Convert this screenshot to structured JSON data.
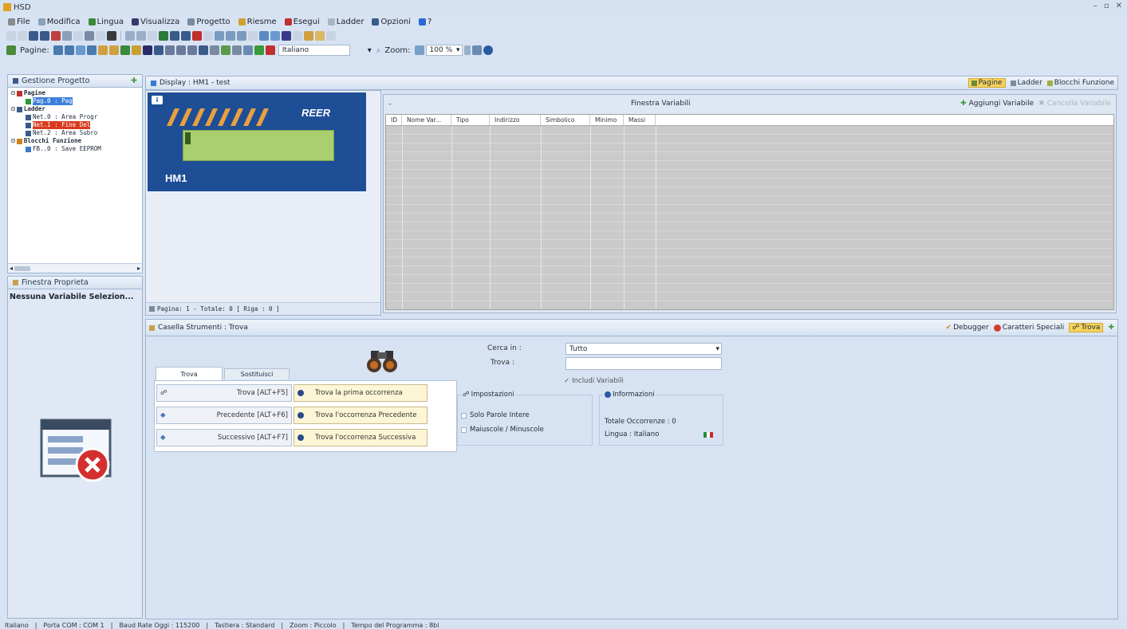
{
  "window": {
    "title": "HSD"
  },
  "menu": [
    {
      "label": "File",
      "icon": "file-icon",
      "color": "#8a8a8a"
    },
    {
      "label": "Modifica",
      "icon": "edit-icon",
      "color": "#8aa0b8"
    },
    {
      "label": "Lingua",
      "icon": "globe-icon",
      "color": "#3a8a3a"
    },
    {
      "label": "Visualizza",
      "icon": "eye-icon",
      "color": "#3a3a6a"
    },
    {
      "label": "Progetto",
      "icon": "project-icon",
      "color": "#7a8aa0"
    },
    {
      "label": "Riesme",
      "icon": "folder-icon",
      "color": "#d0a030"
    },
    {
      "label": "Esegui",
      "icon": "run-icon",
      "color": "#c03030"
    },
    {
      "label": "Ladder",
      "icon": "ladder-icon",
      "color": "#aab4c4"
    },
    {
      "label": "Opzioni",
      "icon": "options-icon",
      "color": "#3a5a8a"
    },
    {
      "label": "?",
      "icon": "help-icon",
      "color": "#2a6ad0"
    }
  ],
  "toolbar3": {
    "pagine_label": "Pagine:",
    "language_value": "Italiano",
    "zoom_label": "Zoom:",
    "zoom_value": "100 %"
  },
  "project": {
    "title": "Gestione Progetto",
    "tree": [
      {
        "text": "Pagine",
        "indent": 0,
        "icon": "pages-folder-icon",
        "style": ""
      },
      {
        "text": "Pag.0 : Pag",
        "indent": 2,
        "icon": "page-arrow-icon",
        "style": "blue"
      },
      {
        "text": "Ladder",
        "indent": 0,
        "icon": "ladder-folder-icon",
        "style": ""
      },
      {
        "text": "Net.0 : Area Progr",
        "indent": 2,
        "icon": "network-icon",
        "style": ""
      },
      {
        "text": "Net.1 : Fine Del",
        "indent": 2,
        "icon": "network-icon",
        "style": "red"
      },
      {
        "text": "Net.2 : Area Subro",
        "indent": 2,
        "icon": "network-icon",
        "style": ""
      },
      {
        "text": "Blocchi Funzione",
        "indent": 0,
        "icon": "function-block-folder-icon",
        "style": ""
      },
      {
        "text": "FB..0 : Save EEPROM",
        "indent": 2,
        "icon": "function-block-icon",
        "style": ""
      }
    ]
  },
  "properties": {
    "title": "Finestra Proprieta",
    "empty_message": "Nessuna Variabile Selezion..."
  },
  "display": {
    "title": "Display : HM1 - test",
    "brand": "REER",
    "screen_name": "HM1",
    "status": "Pagina: 1 - Totale: 0 [ Riga : 0 ]"
  },
  "view_switch": {
    "pagine": "Pagine",
    "ladder": "Ladder",
    "blocchi": "Blocchi Funzione"
  },
  "variables": {
    "title": "Finestra Variabili",
    "add_label": "Aggiungi Variabile",
    "delete_label": "Cancella Variabile",
    "columns": [
      "ID",
      "Nome Var...",
      "Tipo",
      "Indirizzo",
      "Simbolico",
      "Minimo",
      "Massi"
    ]
  },
  "tools": {
    "title": "Casella Strumenti : Trova",
    "tabs": {
      "debugger": "Debugger",
      "caratteri": "Caratteri Speciali",
      "trova": "Trova"
    }
  },
  "find": {
    "tab_find": "Trova",
    "tab_replace": "Sostituisci",
    "rows": [
      {
        "button": "Trova [ALT+F5]",
        "icon": "binoculars-icon",
        "desc": "Trova la prima occorrenza"
      },
      {
        "button": "Precedente [ALT+F6]",
        "icon": "arrow-left-icon",
        "desc": "Trova l'occorrenza Precedente"
      },
      {
        "button": "Successivo [ALT+F7]",
        "icon": "arrow-right-icon",
        "desc": "Trova l'occorrenza Successiva"
      }
    ],
    "cerca_label": "Cerca in :",
    "cerca_value": "Tutto",
    "trova_label": "Trova :",
    "trova_value": "",
    "include_label": "Includi Variabili",
    "settings_title": "Impostazioni",
    "opt_whole": "Solo Parole Intere",
    "opt_case": "Maiuscole / Minuscole",
    "info_title": "Informazioni",
    "total": "Totale Occorrenze : 0",
    "lingua": "Lingua : Italiano"
  },
  "statusbar": {
    "items": [
      "Italiano",
      "Porta COM : COM 1",
      "Baud Rate Oggi : 115200",
      "Tastiera : Standard",
      "Zoom : Piccolo",
      "Tempo del Programma : 8bi"
    ]
  },
  "colors": {
    "bg": "#d7e3f3",
    "display_panel": "#1d4e96",
    "lcd_green": "#a9cf6f",
    "accent_orange": "#e0a020",
    "grid_gray": "#c8c8c8",
    "error_red": "#d83a1f"
  }
}
